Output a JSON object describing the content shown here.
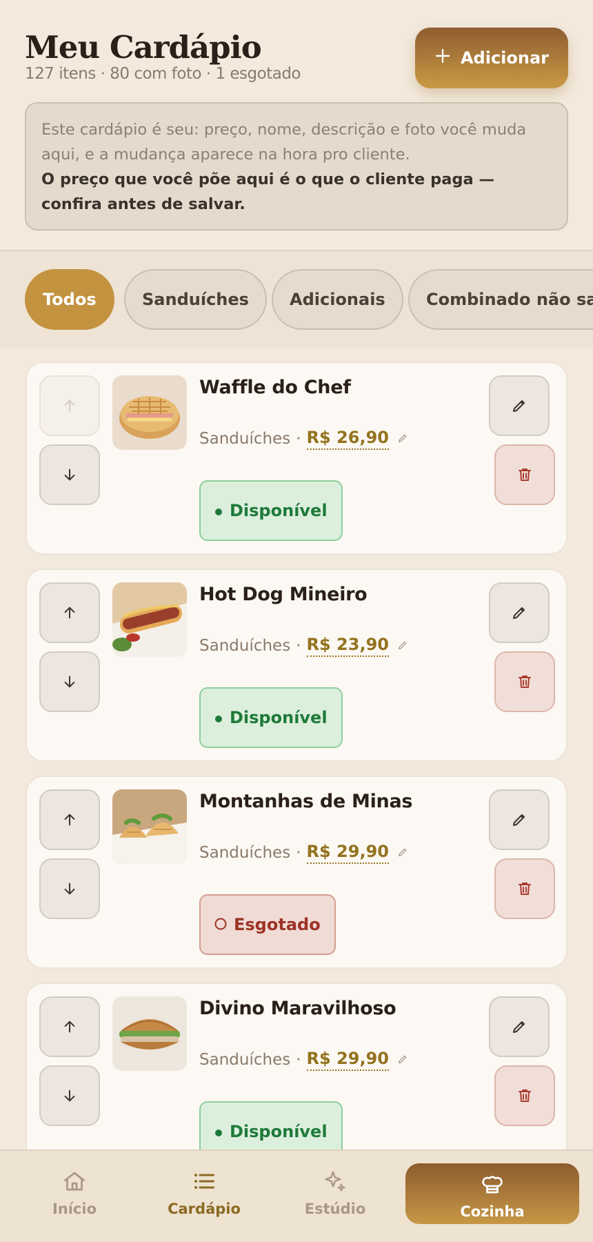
{
  "header": {
    "title": "Meu Cardápio",
    "subtitle": "127 itens · 80 com foto · 1 esgotado",
    "add_label": "Adicionar"
  },
  "notice": {
    "line1": "Este cardápio é seu: preço, nome, descrição e foto você muda aqui, e a mudança aparece na hora pro cliente.",
    "line2": "O preço que você põe aqui é o que o cliente paga — confira antes de salvar."
  },
  "tabs": [
    {
      "label": "Todos",
      "active": true
    },
    {
      "label": "Sanduíches",
      "active": false
    },
    {
      "label": "Adicionais",
      "active": false
    },
    {
      "label": "Combinado não sai",
      "active": false
    }
  ],
  "items": [
    {
      "name": "Waffle do Chef",
      "category": "Sanduíches",
      "separator": "·",
      "price": "R$ 26,90",
      "status": "Disponível",
      "status_type": "available",
      "up_disabled": true
    },
    {
      "name": "Hot Dog Mineiro",
      "category": "Sanduíches",
      "separator": "·",
      "price": "R$ 23,90",
      "status": "Disponível",
      "status_type": "available",
      "up_disabled": false
    },
    {
      "name": "Montanhas de Minas",
      "category": "Sanduíches",
      "separator": "·",
      "price": "R$ 29,90",
      "status": "Esgotado",
      "status_type": "sold-out",
      "up_disabled": false
    },
    {
      "name": "Divino Maravilhoso",
      "category": "Sanduíches",
      "separator": "·",
      "price": "R$ 29,90",
      "status": "Disponível",
      "status_type": "available",
      "up_disabled": false
    }
  ],
  "nav": {
    "home": "Início",
    "menu": "Cardápio",
    "studio": "Estúdio",
    "kitchen": "Cozinha"
  },
  "colors": {
    "accent": "#c39340",
    "available": "#1e7a3a",
    "sold_out": "#9c3326",
    "price": "#94731f"
  }
}
